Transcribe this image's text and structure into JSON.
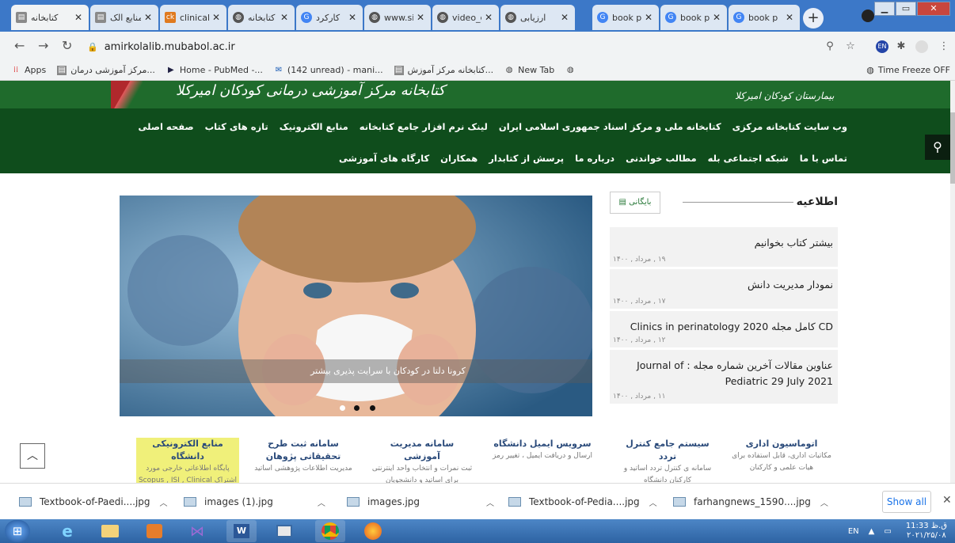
{
  "tabs": [
    {
      "title": "کتابخانه",
      "favicon": "book-icon",
      "active": true
    },
    {
      "title": "منابع الک",
      "favicon": "book-icon",
      "active": false
    },
    {
      "title": "clinical",
      "favicon": "ck-icon",
      "active": false
    },
    {
      "title": "کتابخانه",
      "favicon": "globe-icon",
      "active": false
    },
    {
      "title": "کارکرد",
      "favicon": "google-icon",
      "active": false
    },
    {
      "title": "www.si",
      "favicon": "globe-icon",
      "active": false
    },
    {
      "title": "video_c",
      "favicon": "globe-icon",
      "active": false
    },
    {
      "title": "ارزیابی",
      "favicon": "globe-icon",
      "active": false
    },
    {
      "title": "book p",
      "favicon": "google-icon",
      "active": false
    },
    {
      "title": "book p",
      "favicon": "google-icon",
      "active": false
    },
    {
      "title": "book p",
      "favicon": "google-icon",
      "active": false
    }
  ],
  "toolbar": {
    "url": "amirkolalib.mubabol.ac.ir"
  },
  "bookmarks": {
    "items": [
      {
        "label": "Apps",
        "icon": "apps-grid-icon"
      },
      {
        "label": "مرکز آموزشی درمان...",
        "icon": "book-icon"
      },
      {
        "label": "Home - PubMed -...",
        "icon": "pubmed-icon"
      },
      {
        "label": "(142 unread) - mani...",
        "icon": "mail-icon"
      },
      {
        "label": "کتابخانه مرکز آموزش...",
        "icon": "book-icon"
      },
      {
        "label": "New Tab",
        "icon": "globe-icon"
      },
      {
        "label": "",
        "icon": "globe-icon"
      }
    ],
    "extension": "Time Freeze OFF"
  },
  "site": {
    "header_left": "کتابخانه مرکز آموزشی درمانی کودکان امیرکلا",
    "header_right": "بیمارستان کودکان امیرکلا",
    "nav_row1": [
      "صفحه اصلی",
      "تازه های کتاب",
      "منابع الکترونیک",
      "لینک نرم افزار جامع کتابخانه",
      "کتابخانه ملی و مرکز اسناد جمهوری اسلامی ایران",
      "وب سایت کتابخانه مرکزی"
    ],
    "nav_row2": [
      "کارگاه های آموزشی",
      "همکاران",
      "پرسش از کتابدار",
      "درباره ما",
      "مطالب خواندنی",
      "شبکه اجتماعی بله",
      "تماس با ما"
    ],
    "slide_caption": "کرونا دلتا در کودکان با سرایت پذیری بیشتر",
    "news_title": "اطلاعیه",
    "archive_label": "بایگانی",
    "news": [
      {
        "title": "بیشتر کتاب بخوانیم",
        "date": "۱۹ , مرداد , ۱۴۰۰"
      },
      {
        "title": "نمودار مدیریت دانش",
        "date": "۱۷ , مرداد , ۱۴۰۰"
      },
      {
        "title": "CD کامل مجله Clinics in perinatology 2020",
        "date": "۱۲ , مرداد , ۱۴۰۰"
      },
      {
        "title": "عناوین مقالات آخرین شماره مجله : Journal of Pediatric 29 July 2021",
        "date": "۱۱ , مرداد , ۱۴۰۰"
      }
    ],
    "services": [
      {
        "title": "اتوماسیون اداری",
        "desc": "مکاتبات اداری، قابل استفاده برای هیات علمی و کارکنان"
      },
      {
        "title": "سیستم جامع کنترل تردد",
        "desc": "سامانه ی کنترل تردد اساتید و کارکنان دانشگاه"
      },
      {
        "title": "سرویس ایمیل دانشگاه",
        "desc": "ارسال و دریافت ایمیل ، تغییر رمز"
      },
      {
        "title": "سامانه مدیریت آموزشی",
        "desc": "ثبت نمرات و انتخاب واحد اینترنتی برای اساتید و دانشجویان"
      },
      {
        "title": "سامانه ثبت طرح تحقیقاتی پژوهان",
        "desc": "مدیریت اطلاعات پژوهشی اساتید"
      },
      {
        "title": "منابع الکترونیکی دانشگاه",
        "desc": "پایگاه اطلاعاتی خارجی مورد اشتراک Scopus , ISI , Clinical"
      }
    ]
  },
  "downloads": {
    "items": [
      {
        "name": "Textbook-of-Paedi....jpg"
      },
      {
        "name": "images (1).jpg"
      },
      {
        "name": "images.jpg"
      },
      {
        "name": "Textbook-of-Pedia....jpg"
      },
      {
        "name": "farhangnews_1590....jpg"
      }
    ],
    "show_all": "Show all"
  },
  "taskbar": {
    "lang": "EN",
    "time": "11:33 ق.ظ",
    "date": "۲۰۲۱/۲۵/۰۸"
  }
}
